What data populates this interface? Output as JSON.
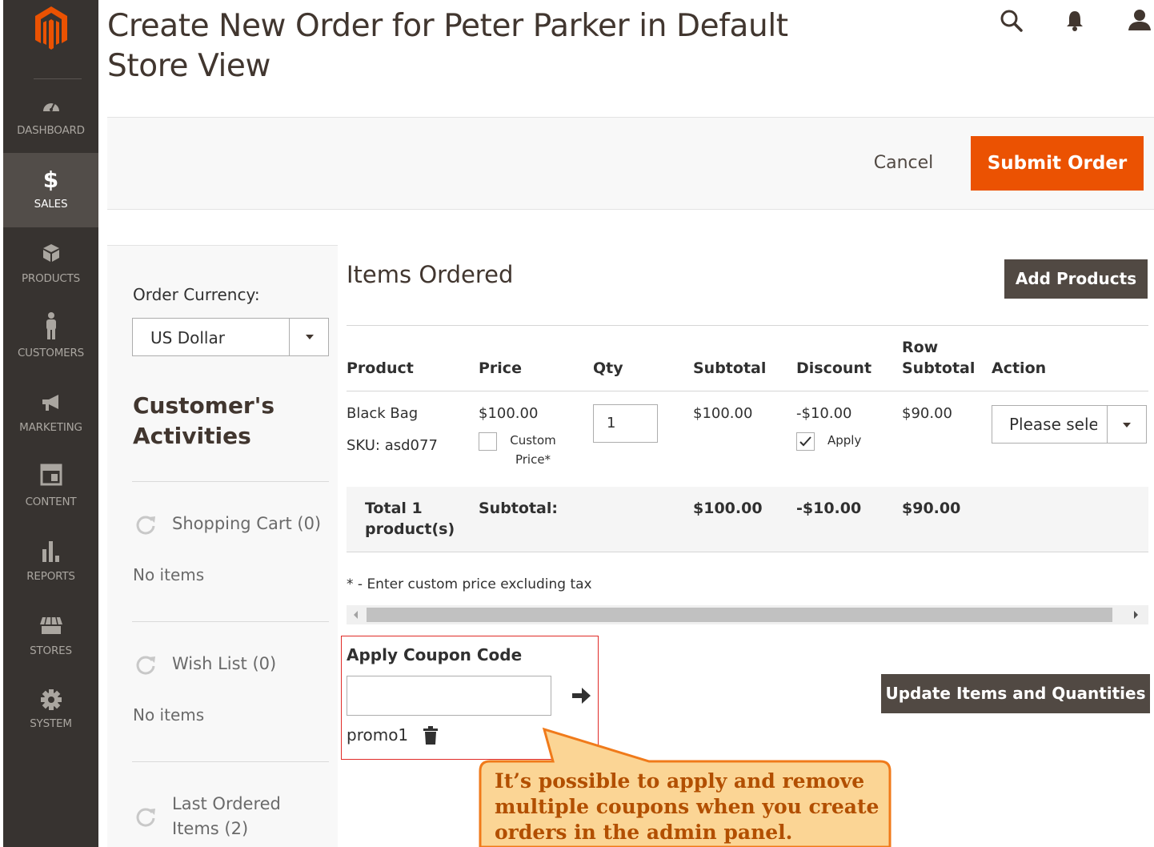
{
  "brand": {
    "logo": "magento-logo-icon",
    "color": "#eb5202"
  },
  "sidebar": {
    "items": [
      {
        "label": "DASHBOARD",
        "icon": "dashboard-gauge-icon"
      },
      {
        "label": "SALES",
        "icon": "dollar-icon",
        "active": true
      },
      {
        "label": "PRODUCTS",
        "icon": "box-icon"
      },
      {
        "label": "CUSTOMERS",
        "icon": "person-icon"
      },
      {
        "label": "MARKETING",
        "icon": "megaphone-icon"
      },
      {
        "label": "CONTENT",
        "icon": "layout-icon"
      },
      {
        "label": "REPORTS",
        "icon": "bar-chart-icon"
      },
      {
        "label": "STORES",
        "icon": "storefront-icon"
      },
      {
        "label": "SYSTEM",
        "icon": "gear-icon"
      }
    ]
  },
  "header": {
    "title": "Create New Order for Peter Parker in Default Store View",
    "icons": [
      "search-icon",
      "bell-icon",
      "user-icon"
    ]
  },
  "actions": {
    "cancel": "Cancel",
    "submit": "Submit Order"
  },
  "left_panel": {
    "currency_label": "Order Currency:",
    "currency_value": "US Dollar",
    "activities_title": "Customer's Activities",
    "sections": [
      {
        "title": "Shopping Cart (0)",
        "empty": "No items"
      },
      {
        "title": "Wish List (0)",
        "empty": "No items"
      },
      {
        "title": "Last Ordered Items (2)"
      }
    ]
  },
  "items": {
    "title": "Items Ordered",
    "add_button": "Add Products",
    "columns": [
      "Product",
      "Price",
      "Qty",
      "Subtotal",
      "Discount",
      "Row Subtotal",
      "Action"
    ],
    "rows": [
      {
        "product": "Black Bag",
        "sku": "SKU: asd077",
        "price": "$100.00",
        "custom_price_label": "Custom Price*",
        "custom_price_checked": false,
        "qty": "1",
        "subtotal": "$100.00",
        "discount": "-$10.00",
        "apply_label": "Apply",
        "apply_checked": true,
        "row_subtotal": "$90.00",
        "action_value": "Please sele"
      }
    ],
    "totals": {
      "label": "Total 1 product(s)",
      "subtotal_label": "Subtotal:",
      "subtotal": "$100.00",
      "discount": "-$10.00",
      "row_subtotal": "$90.00"
    },
    "note": "* - Enter custom price excluding tax",
    "scroll_position": 0.0
  },
  "coupon": {
    "title": "Apply Coupon Code",
    "input_value": "",
    "applied": "promo1"
  },
  "update_button": "Update Items and Quantities",
  "callout": {
    "text": "It’s possible to apply and remove multiple coupons when you create orders in the admin panel.",
    "fill": "#fbd595",
    "border": "#f07a1a",
    "text_color": "#b24f00"
  }
}
